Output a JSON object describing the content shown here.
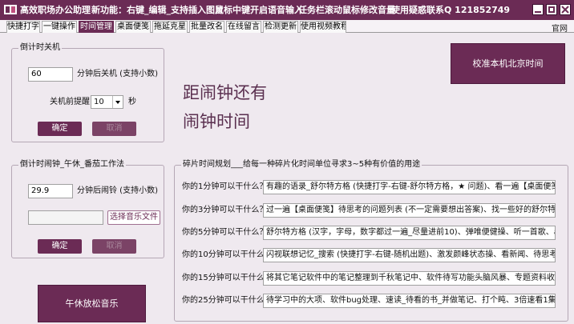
{
  "titlebar": {
    "app_title": "高效职场办公助理",
    "new_feature": "新功能：右键_编辑_支持插入图片",
    "tip_middle_click": "鼠标中键开启语音输入",
    "tip_taskbar": "任务栏滚动鼠标修改音量",
    "contact": "使用疑惑联系Q  121852749"
  },
  "tabs": [
    {
      "label": "快捷打字"
    },
    {
      "label": "一键操作"
    },
    {
      "label": "时间管理"
    },
    {
      "label": "桌面便笺"
    },
    {
      "label": "拖延克星"
    },
    {
      "label": "批量改名"
    },
    {
      "label": "在线留言"
    },
    {
      "label": "检测更新"
    },
    {
      "label": "使用视频教程"
    }
  ],
  "official_link": "官网",
  "shutdown": {
    "legend": "倒计时关机",
    "minutes_value": "60",
    "minutes_suffix": "分钟后关机 (支持小数)",
    "remind_label": "关机前提醒",
    "remind_value": "10",
    "remind_unit": "秒",
    "confirm_label": "确定",
    "cancel_label": "取消"
  },
  "alarm": {
    "legend": "倒计时闹钟_午休_番茄工作法",
    "minutes_value": "29.9",
    "minutes_suffix": "分钟后闹铃 (支持小数)",
    "music_path": "",
    "choose_music_label": "选择音乐文件",
    "confirm_label": "确定",
    "cancel_label": "取消"
  },
  "sync_time_label": "校准本机北京时间",
  "big_text": {
    "line1": "距闹钟还有",
    "line2": "闹钟时间"
  },
  "nap_music_label": "午休放松音乐",
  "fragments": {
    "legend": "碎片时间规划___给每一种碎片化时间单位寻求3~5种有价值的用途",
    "rows": [
      {
        "question": "你的1分钟可以干什么？",
        "answer": "有趣的语录_舒尔特方格 (快捷打字-右键-舒尔特方格，★ 问题)、看一遍【桌面便笺】未达"
      },
      {
        "question": "你的3分钟可以干什么？",
        "answer": "过一遍【桌面便笺】待思考的问题列表 (不一定需要想出答案)、找一些好的舒尔特方格训练"
      },
      {
        "question": "你的5分钟可以干什么？",
        "answer": "舒尔特方格 (汉字，字母，数字都过一遍_尽量进前10)、弹唯便健操、听一首歌、a波音乐闭"
      },
      {
        "question": "你的10分钟可以干什么？",
        "answer": "闪视联想记忆_搜索 (快捷打字-右键-随机出题)、激发颜峰状态操、看新闻、待思考的问题列"
      },
      {
        "question": "你的15分钟可以干什么？",
        "answer": "将其它笔记软件中的笔记整理到千秋笔记中、软件待写功能头脑风暴、专题资料收集、"
      },
      {
        "question": "你的25分钟可以干什么？",
        "answer": "待学习中的大项、软件bug处理、速读_待看的书_并做笔记、打个盹、3倍速看1集视频节目并"
      }
    ]
  },
  "colors": {
    "accent": "#6b2b55",
    "background": "#efe9ef"
  }
}
